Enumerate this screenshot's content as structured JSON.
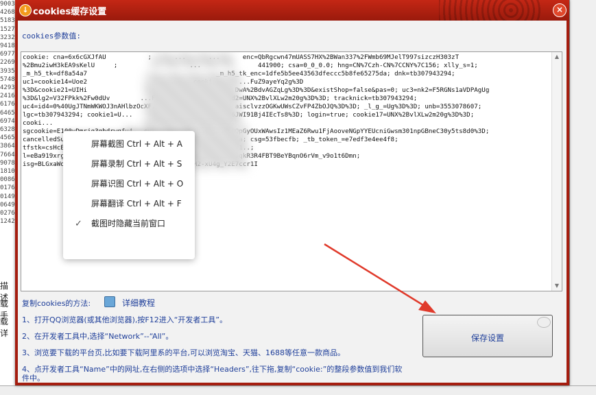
{
  "dialog": {
    "title": "cookies缓存设置",
    "param_label": "cookies参数值:",
    "cookie_lines": [
      "cookie: cna=6x6cGXJfAU           ;      ...      ...      enc=QbRgcwn47mUASS7HX%2BWan337%2FWmb69MJelT997sizczH303zT",
      "%2Bmu2iwH3kEA9sKelU     ;                   ...               441900; csa=0_0_0.0; hng=CN%7Czh-CN%7CCNY%7C156; xlly_s=1;",
      "_m_h5_tk=df8a54a7                                  _m_h5_tk_enc=1dfe5b5ee43563dfeccc5b8fe65275da; dnk=tb307943294;",
      "uc1=cookie14=Uoe2                     ...    cooki       ...FuZ9ayeYq2g%3D",
      "%3D&cookie21=UIHi                  ...      =W5iHLL...  DwA%2BdvAGZqLg%3D%3D&existShop=false&pas=0; uc3=nk2=F5RGNs1aVDPAgUg",
      "%3D&lg2=V32FPkk%2Fw0dUv        ...F8dCujHo...       d&id2=UNX%2BvlXLw2m20g%3D%3D; tracknick=tb307943294;",
      "uc4=id4=0%40UgJTNmWKWOJ3nAHlbzOcXF...                   aisclvzzOGKwUWsCZvFP4ZbOJQ%3D%3D; _l_g_=Ug%3D%3D; unb=3553078607;",
      "lgc=tb307943294; cookie1=U...                   ...afr86JWI91Bj4IEcTs8%3D; login=true; cookie17=UNX%2BvlXLw2m20g%3D%3D;",
      "cooki...                              nk_=tb307943294;",
      "sgcookie=E100yDmrjg3ghdrwqfu4...evYaCsuNCZBorem4JwAyfN10QpGyOUxWAwsIz1MEaZ6Rwu1FjAooveNGpYYEUcniGwsm301npGBneC30y5ts8d0%3D;",
      "cancelledSubSites=empty; t=d05...3cbae921b91658...  sg=47a; csg=53fbecfb; _tb_token_=e7edf3e4ee4f8;",
      "tfstk=csHcB_OWFjPfeePoOKwiOODXWR...           ...i5lrW4d11..;",
      "l=eBa919xrgTHl...                     ...rpOW6nrHGBCnGVh6qkR3R4FBT9BeYBqnO6rVm_v9o1t6Dmn;",
      "isg=BLGxaWdudG...                    ...iXutEM2-xU4g_Y2E7ccr1I"
    ],
    "howto_title": "复制cookies的方法:",
    "tutorial_link": "详细教程",
    "steps": [
      "1、打开QQ浏览器(或其他浏览器),按F12进入“开发者工具”。",
      "2、在开发者工具中,选择“Network”--“All”。",
      "3、浏览要下载的平台页,比如要下载阿里系的平台,可以浏览淘宝、天猫、1688等任意一款商品。",
      "4、点开发者工具“Name”中的网址,在右侧的选项中选择“Headers”,往下拖,复制“cookie:”的整段参数值到我们软件中。"
    ],
    "save_label": "保存设置"
  },
  "context_menu": {
    "items": [
      {
        "label": "屏幕截图 Ctrl + Alt + A",
        "checked": false
      },
      {
        "label": "屏幕录制 Ctrl + Alt + S",
        "checked": false
      },
      {
        "label": "屏幕识图 Ctrl + Alt + O",
        "checked": false
      },
      {
        "label": "屏幕翻译 Ctrl + Alt + F",
        "checked": false
      },
      {
        "label": "截图时隐藏当前窗口",
        "checked": true
      }
    ]
  },
  "background": {
    "left_numbers": [
      "9003",
      "4268",
      "5183",
      "1527",
      "3232",
      "9418",
      "6977",
      "2269",
      "3935",
      "5748",
      "4293",
      "2416",
      "6176",
      "6465",
      "6974",
      "6328",
      "4565",
      "3864",
      "7664",
      "9078",
      "1810",
      "0086",
      "0176",
      "0149",
      "0649",
      "0276",
      "1242"
    ],
    "left_labels": [
      "描述",
      "载手",
      "载详"
    ]
  },
  "colors": {
    "title_bar": "#b02212",
    "link_text": "#1f3f9a",
    "arrow": "#e03a2b"
  }
}
